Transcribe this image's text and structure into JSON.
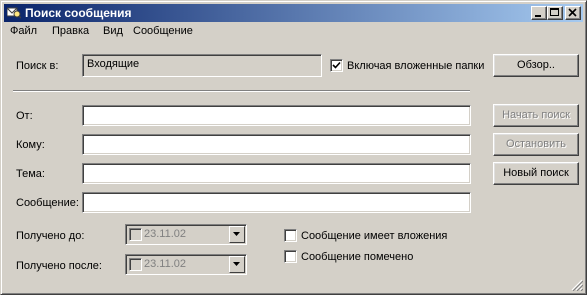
{
  "window": {
    "title": "Поиск сообщения",
    "minimize_icon": "minimize-icon",
    "maximize_icon": "maximize-icon",
    "close_icon": "close-icon"
  },
  "menu": {
    "file": "Файл",
    "edit": "Правка",
    "view": "Вид",
    "message": "Сообщение"
  },
  "search_in": {
    "label": "Поиск в:",
    "value": "Входящие",
    "include_subfolders_label": "Включая вложенные папки",
    "include_subfolders_checked": true,
    "browse_button": "Обзор.."
  },
  "fields": {
    "from_label": "От:",
    "from_value": "",
    "to_label": "Кому:",
    "to_value": "",
    "subject_label": "Тема:",
    "subject_value": "",
    "message_label": "Сообщение:",
    "message_value": ""
  },
  "dates": {
    "received_before_label": "Получено до:",
    "received_before_value": "23.11.02",
    "received_after_label": "Получено после:",
    "received_after_value": "23.11.02"
  },
  "options": {
    "has_attachments_label": "Сообщение имеет вложения",
    "flagged_label": "Сообщение помечено"
  },
  "buttons": {
    "start_search": "Начать поиск",
    "stop": "Остановить",
    "new_search": "Новый поиск"
  }
}
